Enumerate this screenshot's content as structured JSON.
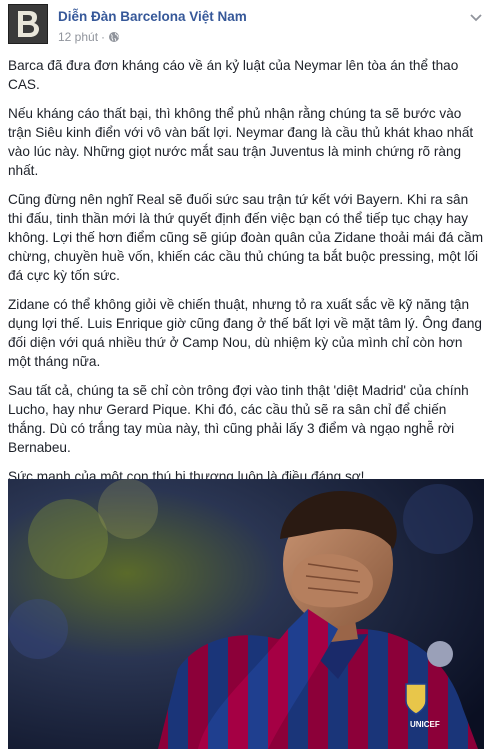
{
  "post": {
    "author": "Diễn Đàn Barcelona Việt Nam",
    "timestamp": "12 phút",
    "separator": "·",
    "icons": {
      "avatar": "page-logo-icon",
      "privacy": "globe-icon",
      "menu": "chevron-down-icon"
    },
    "paragraphs": [
      "Barca đã đưa đơn kháng cáo về án kỷ luật của Neymar lên tòa án thể thao CAS.",
      "Nếu kháng cáo thất bại, thì không thể phủ nhận rằng chúng ta sẽ bước vào trận Siêu kinh điển với vô vàn bất lợi. Neymar đang là cầu thủ khát khao nhất vào lúc này. Những giọt nước mắt sau trận Juventus là minh chứng rõ ràng nhất.",
      "Cũng đừng nên nghĩ Real sẽ đuối sức sau trận tứ kết với Bayern. Khi ra sân thi đấu, tinh thần mới là thứ quyết định đến việc bạn có thể tiếp tục chạy hay không. Lợi thế hơn điểm cũng sẽ giúp đoàn quân của Zidane thoải mái đá cầm chừng, chuyền huề vốn, khiến các cầu thủ chúng ta bắt buộc pressing, một lối đá cực kỳ tốn sức.",
      "Zidane có thể không giỏi về chiến thuật, nhưng tỏ ra xuất sắc về kỹ năng tận dụng lợi thế. Luis Enrique giờ cũng đang ở thế bất lợi về mặt tâm lý. Ông đang đối diện với quá nhiều thứ ở Camp Nou, dù nhiệm kỳ của mình chỉ còn hơn một tháng nữa.",
      "Sau tất cả, chúng ta sẽ chỉ còn trông đợi vào tinh thật 'diệt Madrid' của chính Lucho, hay như Gerard Pique. Khi đó, các cầu thủ sẽ ra sân chỉ để chiến thắng. Dù có trắng tay mùa này, thì cũng phải lấy 3 điểm và ngạo nghễ rời Bernabeu.",
      "Sức mạnh của một con thú bị thương luôn là điều đáng sợ!"
    ],
    "photo_text": {
      "sponsor": "UNICEF",
      "avatar_letter": "B"
    }
  },
  "colors": {
    "link": "#365899",
    "meta": "#90949c",
    "text": "#1d2129",
    "kit_blue": "#1f3f8f",
    "kit_red": "#a50044"
  }
}
